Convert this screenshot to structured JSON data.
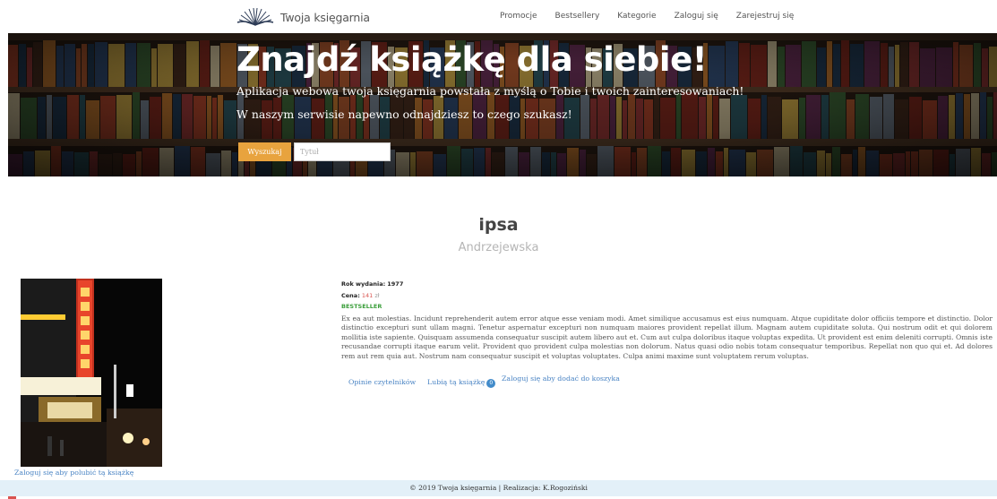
{
  "navbar": {
    "brand": "Twoja księgarnia",
    "links": [
      "Promocje",
      "Bestsellery",
      "Kategorie",
      "Zaloguj się",
      "Zarejestruj się"
    ]
  },
  "hero": {
    "title": "Znajdź książkę dla siebie!",
    "line1": "Aplikacja webowa twoja księgarnia powstała z myślą o Tobie i twoich zainteresowaniach!",
    "line2": "W naszym serwisie napewno odnajdziesz to czego szukasz!",
    "search_button": "Wyszukaj",
    "search_placeholder": "Tytuł"
  },
  "book": {
    "title": "ipsa",
    "author": "Andrzejewska",
    "year_label": "Rok wydania:",
    "year": "1977",
    "price_label": "Cena:",
    "price": "141",
    "currency": "zł",
    "badge": "BESTSELLER",
    "description": "Ex ea aut molestias. Incidunt reprehenderit autem error atque esse veniam modi. Amet similique accusamus est eius numquam. Atque cupiditate dolor officiis tempore et distinctio. Dolor distinctio excepturi sunt ullam magni. Tenetur aspernatur excepturi non numquam maiores provident repellat illum. Magnam autem cupiditate soluta. Qui nostrum odit et qui dolorem mollitia iste sapiente. Quisquam assumenda consequatur suscipit autem libero aut et. Cum aut culpa doloribus itaque voluptas expedita. Ut provident est enim deleniti corrupti. Omnis iste recusandae corrupti itaque earum velit. Provident quo provident culpa molestias non dolorum. Natus quasi odio nobis totam consequatur temporibus. Repellat non quo qui et. Ad dolores rem aut rem quia aut. Nostrum nam consequatur suscipit et voluptas voluptates. Culpa animi maxime sunt voluptatem rerum voluptas.",
    "reviews_link": "Opinie czytelników",
    "likes_label": "Lubią tą książkę",
    "likes_count": "0",
    "cart_login": "Zaloguj się aby dodać do koszyka",
    "like_login": "Zaloguj się aby polubić tą książkę"
  },
  "footer": {
    "text": "© 2019 Twoja księgarnia | Realizacja: K.Rogoziński"
  },
  "colors": {
    "accent": "#e8a33e",
    "link": "#4a84c4",
    "footer_bg": "#e3f0f8",
    "bestseller": "#3a9e3a",
    "price": "#d9534f"
  }
}
